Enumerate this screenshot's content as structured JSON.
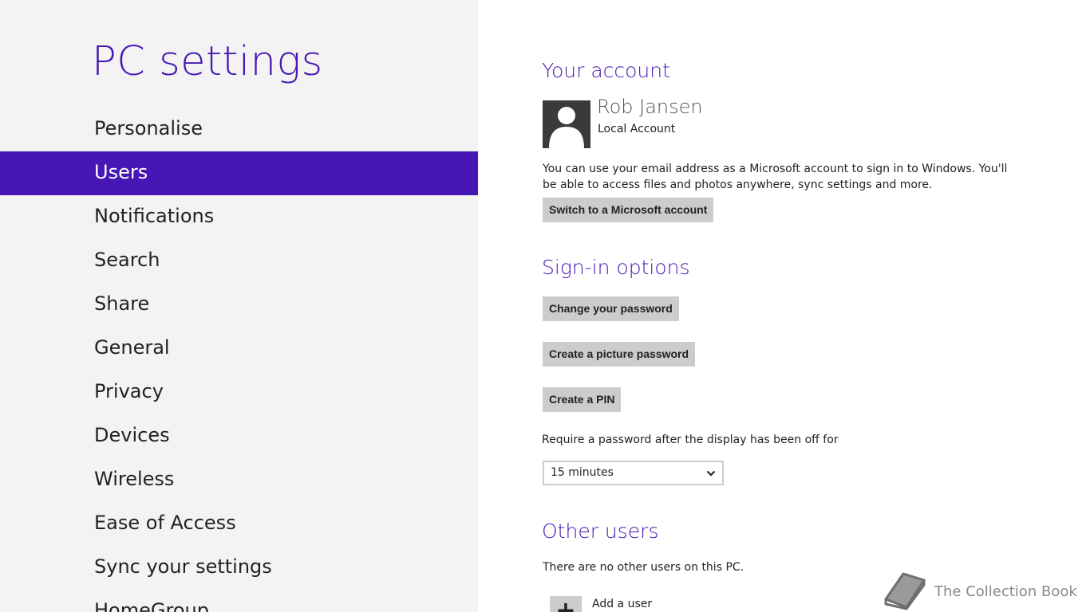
{
  "nav": {
    "title": "PC settings",
    "items": [
      {
        "label": "Personalise"
      },
      {
        "label": "Users",
        "selected": true
      },
      {
        "label": "Notifications"
      },
      {
        "label": "Search"
      },
      {
        "label": "Share"
      },
      {
        "label": "General"
      },
      {
        "label": "Privacy"
      },
      {
        "label": "Devices"
      },
      {
        "label": "Wireless"
      },
      {
        "label": "Ease of Access"
      },
      {
        "label": "Sync your settings"
      },
      {
        "label": "HomeGroup"
      }
    ]
  },
  "account": {
    "heading": "Your account",
    "user_name": "Rob Jansen",
    "account_type": "Local Account",
    "description": "You can use your email address as a Microsoft account to sign in to Windows. You'll be able to access files and photos anywhere, sync settings and more.",
    "switch_button": "Switch to a Microsoft account"
  },
  "signin": {
    "heading": "Sign-in options",
    "change_password_button": "Change your password",
    "picture_password_button": "Create a picture password",
    "pin_button": "Create a PIN",
    "require_label": "Require a password after the display has been off for",
    "require_selected": "15 minutes"
  },
  "other_users": {
    "heading": "Other users",
    "empty_text": "There are no other users on this PC.",
    "add_user_label": "Add a user",
    "add_icon_glyph": "+"
  },
  "watermark": {
    "text": "The Collection Book",
    "icon": "book-icon"
  },
  "colors": {
    "accent": "#4617b4",
    "nav_background": "#f3f3f3",
    "button_background": "#cccccc"
  }
}
